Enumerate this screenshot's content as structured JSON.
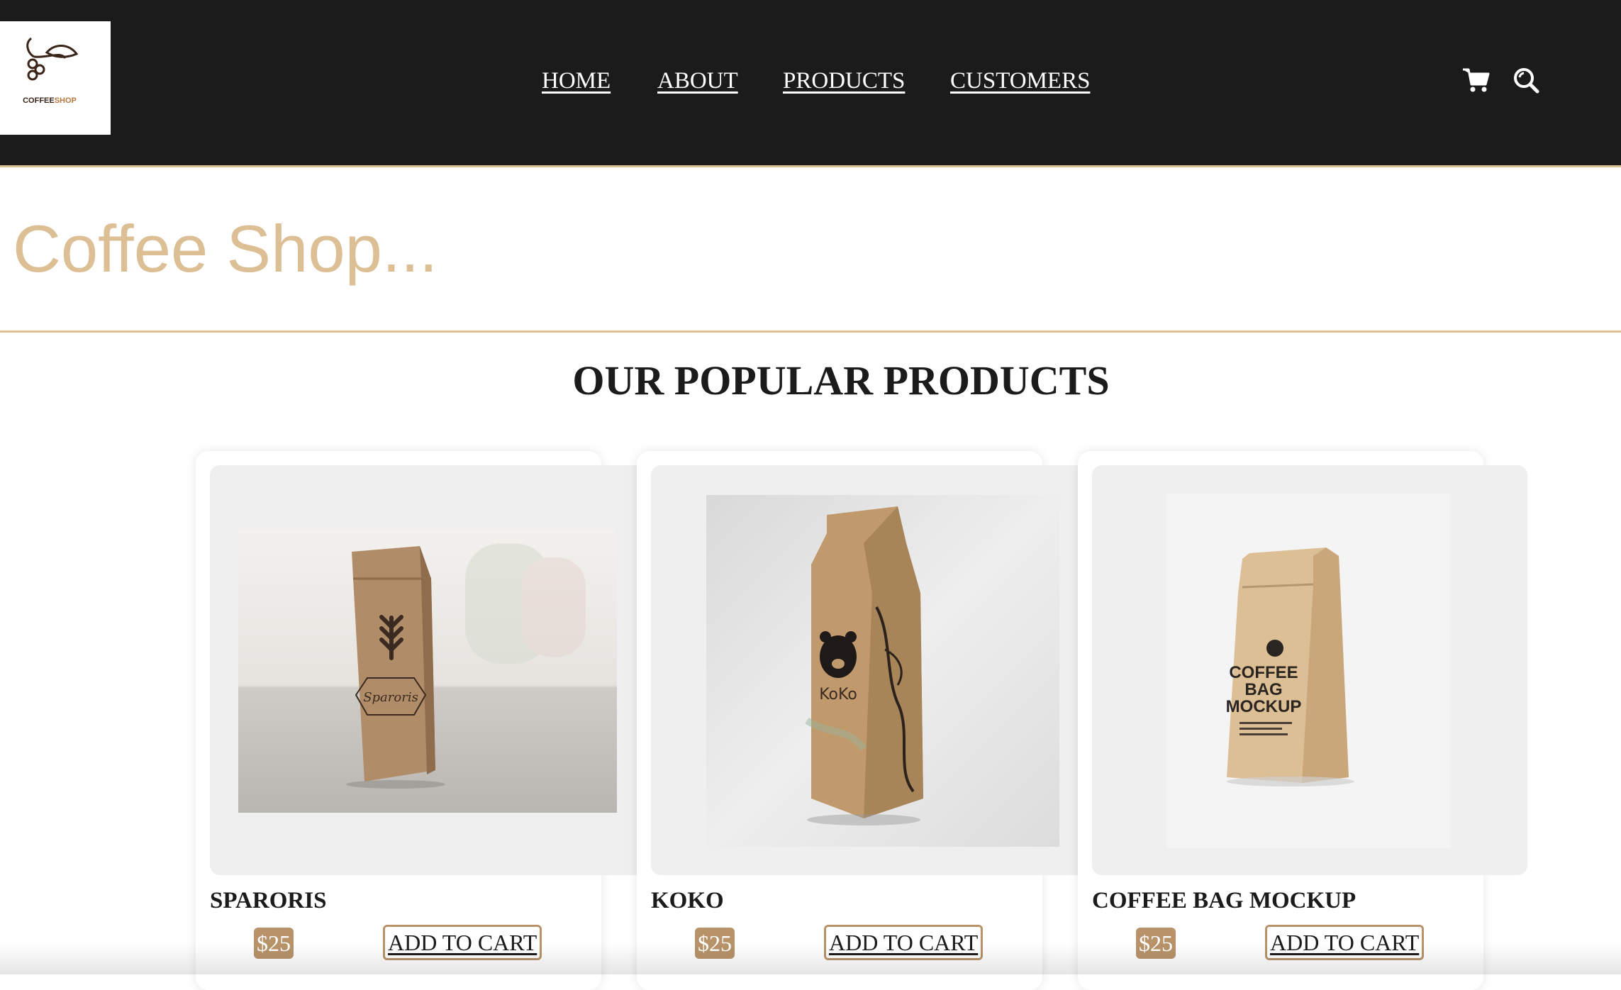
{
  "header": {
    "logo": {
      "text_main": "COFFEE",
      "text_accent": "SHOP"
    },
    "nav": [
      "HOME",
      "ABOUT",
      "PRODUCTS",
      "CUSTOMERS"
    ],
    "icons": [
      "cart-icon",
      "search-icon"
    ]
  },
  "hero": {
    "title": "Coffee Shop..."
  },
  "products_section": {
    "title": "OUR POPULAR PRODUCTS",
    "products": [
      {
        "name": "SPARORIS",
        "price": "$25",
        "button": "ADD TO CART",
        "bag_text": "Sparoris"
      },
      {
        "name": "KOKO",
        "price": "$25",
        "button": "ADD TO CART",
        "bag_text": "KoKo"
      },
      {
        "name": "COFFEE BAG MOCKUP",
        "price": "$25",
        "button": "ADD TO CART",
        "bag_lines": [
          "COFFEE",
          "BAG",
          "MOCKUP"
        ]
      }
    ]
  },
  "colors": {
    "header_bg": "#1b1b1b",
    "accent": "#dcbf95",
    "price_bg": "#b8936a"
  }
}
